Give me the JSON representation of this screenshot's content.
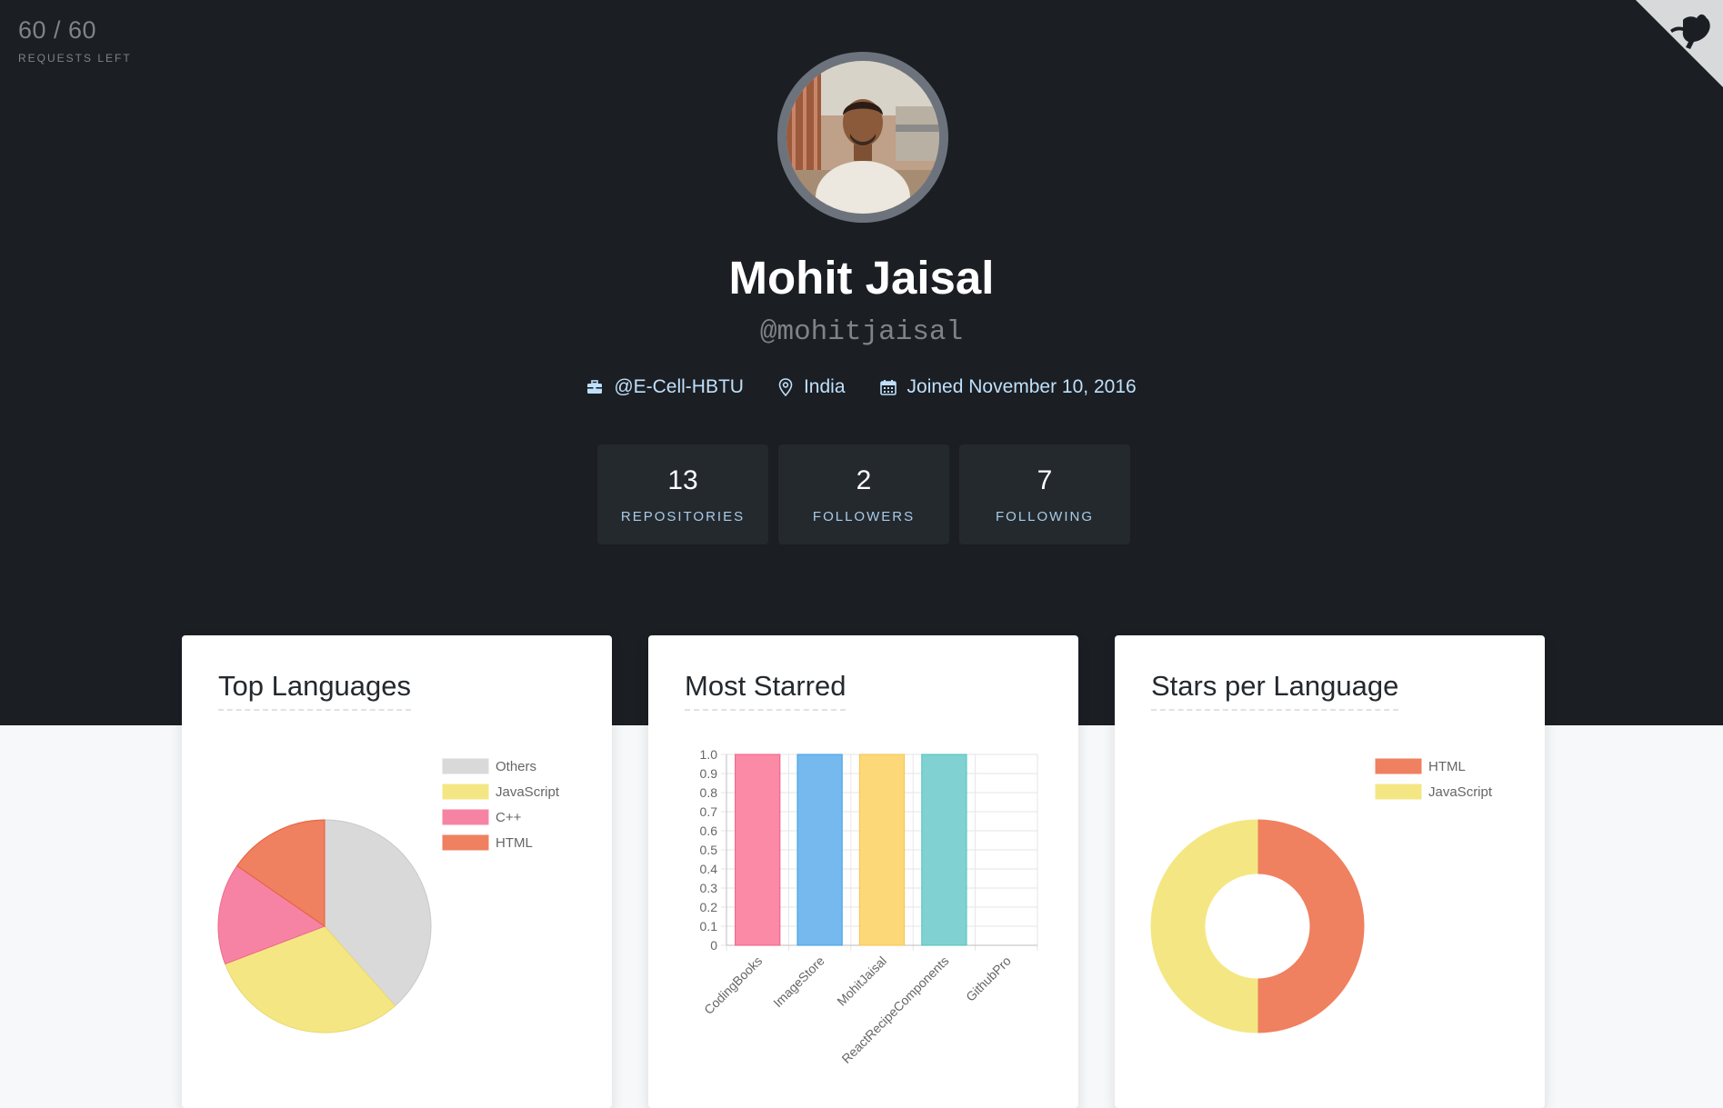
{
  "rate_limit": {
    "count": "60 / 60",
    "label": "REQUESTS LEFT"
  },
  "corner_icon": "octocat-icon",
  "profile": {
    "name": "Mohit Jaisal",
    "login": "@mohitjaisal",
    "company": "@E-Cell-HBTU",
    "location": "India",
    "joined": "Joined November 10, 2016"
  },
  "icons": {
    "company": "briefcase-icon",
    "location": "map-pin-icon",
    "joined": "calendar-icon"
  },
  "stats": {
    "repositories": {
      "value": "13",
      "label": "REPOSITORIES"
    },
    "followers": {
      "value": "2",
      "label": "FOLLOWERS"
    },
    "following": {
      "value": "7",
      "label": "FOLLOWING"
    }
  },
  "cards": {
    "top_languages": "Top Languages",
    "most_starred": "Most Starred",
    "stars_per_language": "Stars per Language"
  },
  "colors": {
    "header_bg": "#1b1e23",
    "page_bg": "#f6f8fa",
    "stat_bg": "#24292e",
    "accent_text": "#bfe0fa"
  },
  "chart_data": [
    {
      "type": "pie",
      "categories": [
        "Others",
        "JavaScript",
        "C++",
        "HTML"
      ],
      "values": [
        5,
        4,
        2,
        2
      ],
      "colors": [
        "#d9d9d9",
        "#f4e783",
        "#f783a4",
        "#ef8060"
      ],
      "legend": "top-right"
    },
    {
      "type": "bar",
      "categories": [
        "CodingBooks",
        "ImageStore",
        "MohitJaisal",
        "ReactRecipeComponents",
        "GithubPro"
      ],
      "values": [
        1,
        1,
        1,
        1,
        0
      ],
      "colors": [
        "#fb8aa6",
        "#75b9ee",
        "#fdd878",
        "#80d2d2",
        "#d9d9d9"
      ],
      "ylim": [
        0,
        1
      ],
      "yticks": [
        "0",
        "0.1",
        "0.2",
        "0.3",
        "0.4",
        "0.5",
        "0.6",
        "0.7",
        "0.8",
        "0.9",
        "1.0"
      ],
      "grid": true
    },
    {
      "type": "pie",
      "subtype": "doughnut",
      "categories": [
        "HTML",
        "JavaScript"
      ],
      "values": [
        1,
        1
      ],
      "colors": [
        "#ef8060",
        "#f4e783"
      ],
      "legend": "top-right"
    }
  ]
}
